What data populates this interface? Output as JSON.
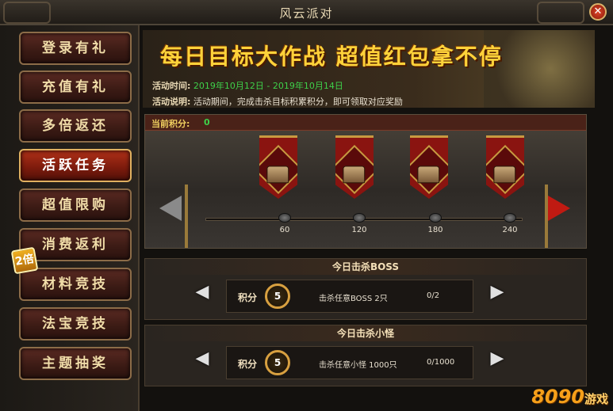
{
  "window": {
    "title": "风云派对",
    "close_glyph": "✕"
  },
  "sidebar": {
    "items": [
      {
        "label": "登录有礼",
        "active": false
      },
      {
        "label": "充值有礼",
        "active": false
      },
      {
        "label": "多倍返还",
        "active": false
      },
      {
        "label": "活跃任务",
        "active": true
      },
      {
        "label": "超值限购",
        "active": false
      },
      {
        "label": "消费返利",
        "active": false
      },
      {
        "label": "材料竞技",
        "active": false
      },
      {
        "label": "法宝竞技",
        "active": false
      },
      {
        "label": "主题抽奖",
        "active": false
      }
    ],
    "badge": "2倍"
  },
  "banner": {
    "headline": "每日目标大作战  超值红包拿不停",
    "time_label": "活动时间:",
    "time_value": "2019年10月12日 - 2019年10月14日",
    "desc_label": "活动说明:",
    "desc_value": "活动期间，完成击杀目标积累积分，即可领取对应奖励"
  },
  "progress": {
    "score_label": "当前积分:",
    "score_value": "0",
    "milestones": [
      "60",
      "120",
      "180",
      "240"
    ],
    "reward_icon": "treasure-chest-icon"
  },
  "tasks": [
    {
      "title": "今日击杀BOSS",
      "score_label": "积分",
      "points": "5",
      "description": "击杀任意BOSS 2只",
      "progress": "0/2"
    },
    {
      "title": "今日击杀小怪",
      "score_label": "积分",
      "points": "5",
      "description": "击杀任意小怪 1000只",
      "progress": "0/1000"
    }
  ],
  "arrows": {
    "left": "◀",
    "right": "▶"
  },
  "watermark": {
    "brand": "8090",
    "suffix": "游戏"
  },
  "colors": {
    "accent": "#ffd23a",
    "green": "#3ed04a",
    "red": "#c01a12"
  }
}
